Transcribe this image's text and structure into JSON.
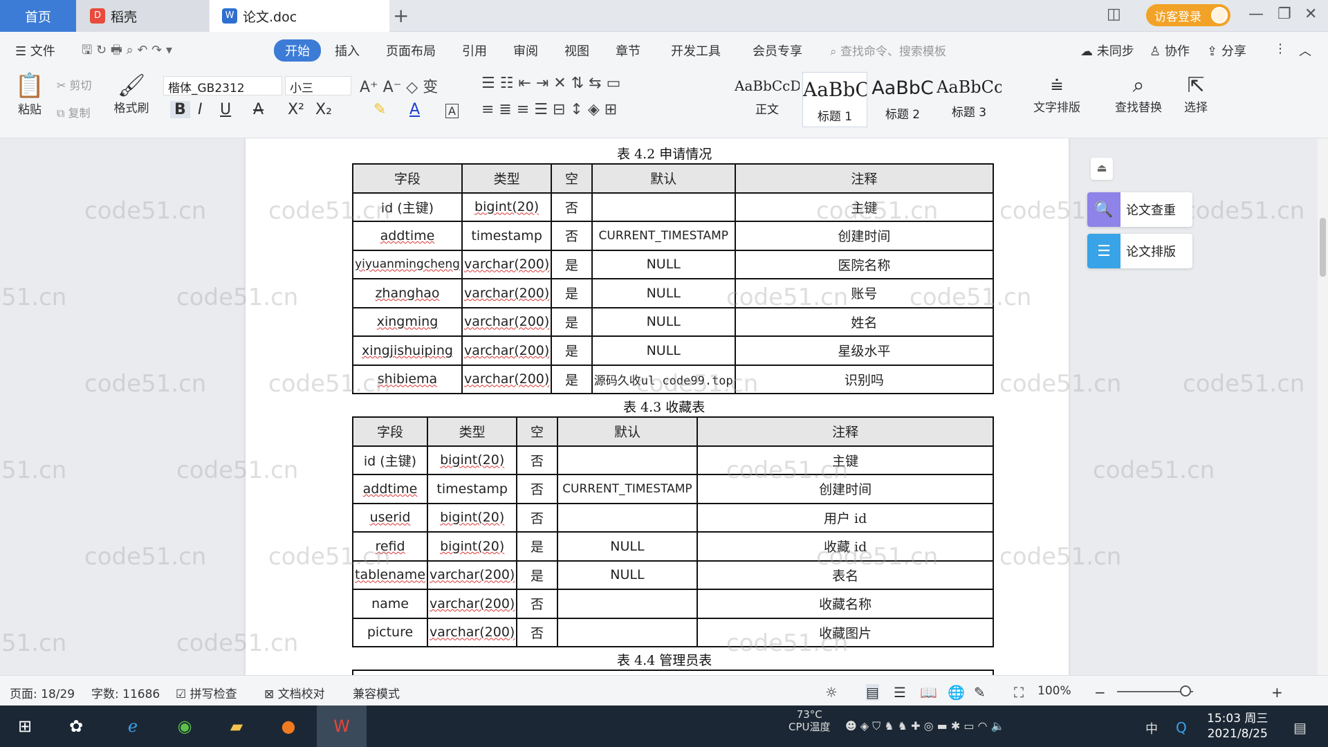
{
  "tabs": {
    "home": "首页",
    "daoke": "稻壳",
    "doc": "论文.doc",
    "new_tab": "+"
  },
  "titlebar": {
    "visitor_login": "访客登录"
  },
  "menubar": {
    "file": "文件",
    "items": [
      "开始",
      "插入",
      "页面布局",
      "引用",
      "审阅",
      "视图",
      "章节",
      "开发工具",
      "会员专享"
    ],
    "search_placeholder": "查找命令、搜索模板",
    "unsynced": "未同步",
    "collab": "协作",
    "share": "分享"
  },
  "ribbon": {
    "paste": "粘贴",
    "cut": "剪切",
    "copy": "复制",
    "format_painter": "格式刷",
    "font": "楷体_GB2312",
    "size": "小三",
    "styles": [
      {
        "sample": "AaBbCcDd",
        "label": "正文"
      },
      {
        "sample": "AaBbC",
        "label": "标题 1"
      },
      {
        "sample": "AaBbC",
        "label": "标题 2"
      },
      {
        "sample": "AaBbCcI",
        "label": "标题 3"
      }
    ],
    "text_layout": "文字排版",
    "find_replace": "查找替换",
    "select": "选择"
  },
  "document": {
    "table2": {
      "caption": "表 4.2  申请情况",
      "headers": [
        "字段",
        "类型",
        "空",
        "默认",
        "注释"
      ],
      "rows": [
        [
          "id (主键)",
          "bigint(20)",
          "否",
          "",
          "主键"
        ],
        [
          "addtime",
          "timestamp",
          "否",
          "CURRENT_TIMESTAMP",
          "创建时间"
        ],
        [
          "yiyuanmingcheng",
          "varchar(200)",
          "是",
          "NULL",
          "医院名称"
        ],
        [
          "zhanghao",
          "varchar(200)",
          "是",
          "NULL",
          "账号"
        ],
        [
          "xingming",
          "varchar(200)",
          "是",
          "NULL",
          "姓名"
        ],
        [
          "xingjishuiping",
          "varchar(200)",
          "是",
          "NULL",
          "星级水平"
        ],
        [
          "shibiema",
          "varchar(200)",
          "是",
          "",
          "识别吗"
        ]
      ],
      "overlay_text": "源码久收ul code99.top"
    },
    "table3": {
      "caption": "表 4.3  收藏表",
      "headers": [
        "字段",
        "类型",
        "空",
        "默认",
        "注释"
      ],
      "rows": [
        [
          "id (主键)",
          "bigint(20)",
          "否",
          "",
          "主键"
        ],
        [
          "addtime",
          "timestamp",
          "否",
          "CURRENT_TIMESTAMP",
          "创建时间"
        ],
        [
          "userid",
          "bigint(20)",
          "否",
          "",
          "用户 id"
        ],
        [
          "refid",
          "bigint(20)",
          "是",
          "NULL",
          "收藏 id"
        ],
        [
          "tablename",
          "varchar(200)",
          "是",
          "NULL",
          "表名"
        ],
        [
          "name",
          "varchar(200)",
          "否",
          "",
          "收藏名称"
        ],
        [
          "picture",
          "varchar(200)",
          "否",
          "",
          "收藏图片"
        ]
      ]
    },
    "table4": {
      "caption": "表 4.4  管理员表"
    }
  },
  "watermark": "code51.cn",
  "side_panel": {
    "check": "论文查重",
    "layout": "论文排版"
  },
  "statusbar": {
    "page": "页面: 18/29",
    "words": "字数: 11686",
    "spellcheck": "拼写检查",
    "doc_proof": "文档校对",
    "compat": "兼容模式",
    "zoom": "100%"
  },
  "taskbar": {
    "cpu_temp": "73°C",
    "cpu_label": "CPU温度",
    "ime": "中",
    "time": "15:03 周三",
    "date": "2021/8/25"
  },
  "colors": {
    "accent": "#3c7cd6",
    "visitor": "#f2a226",
    "taskbar": "#1b2734"
  }
}
